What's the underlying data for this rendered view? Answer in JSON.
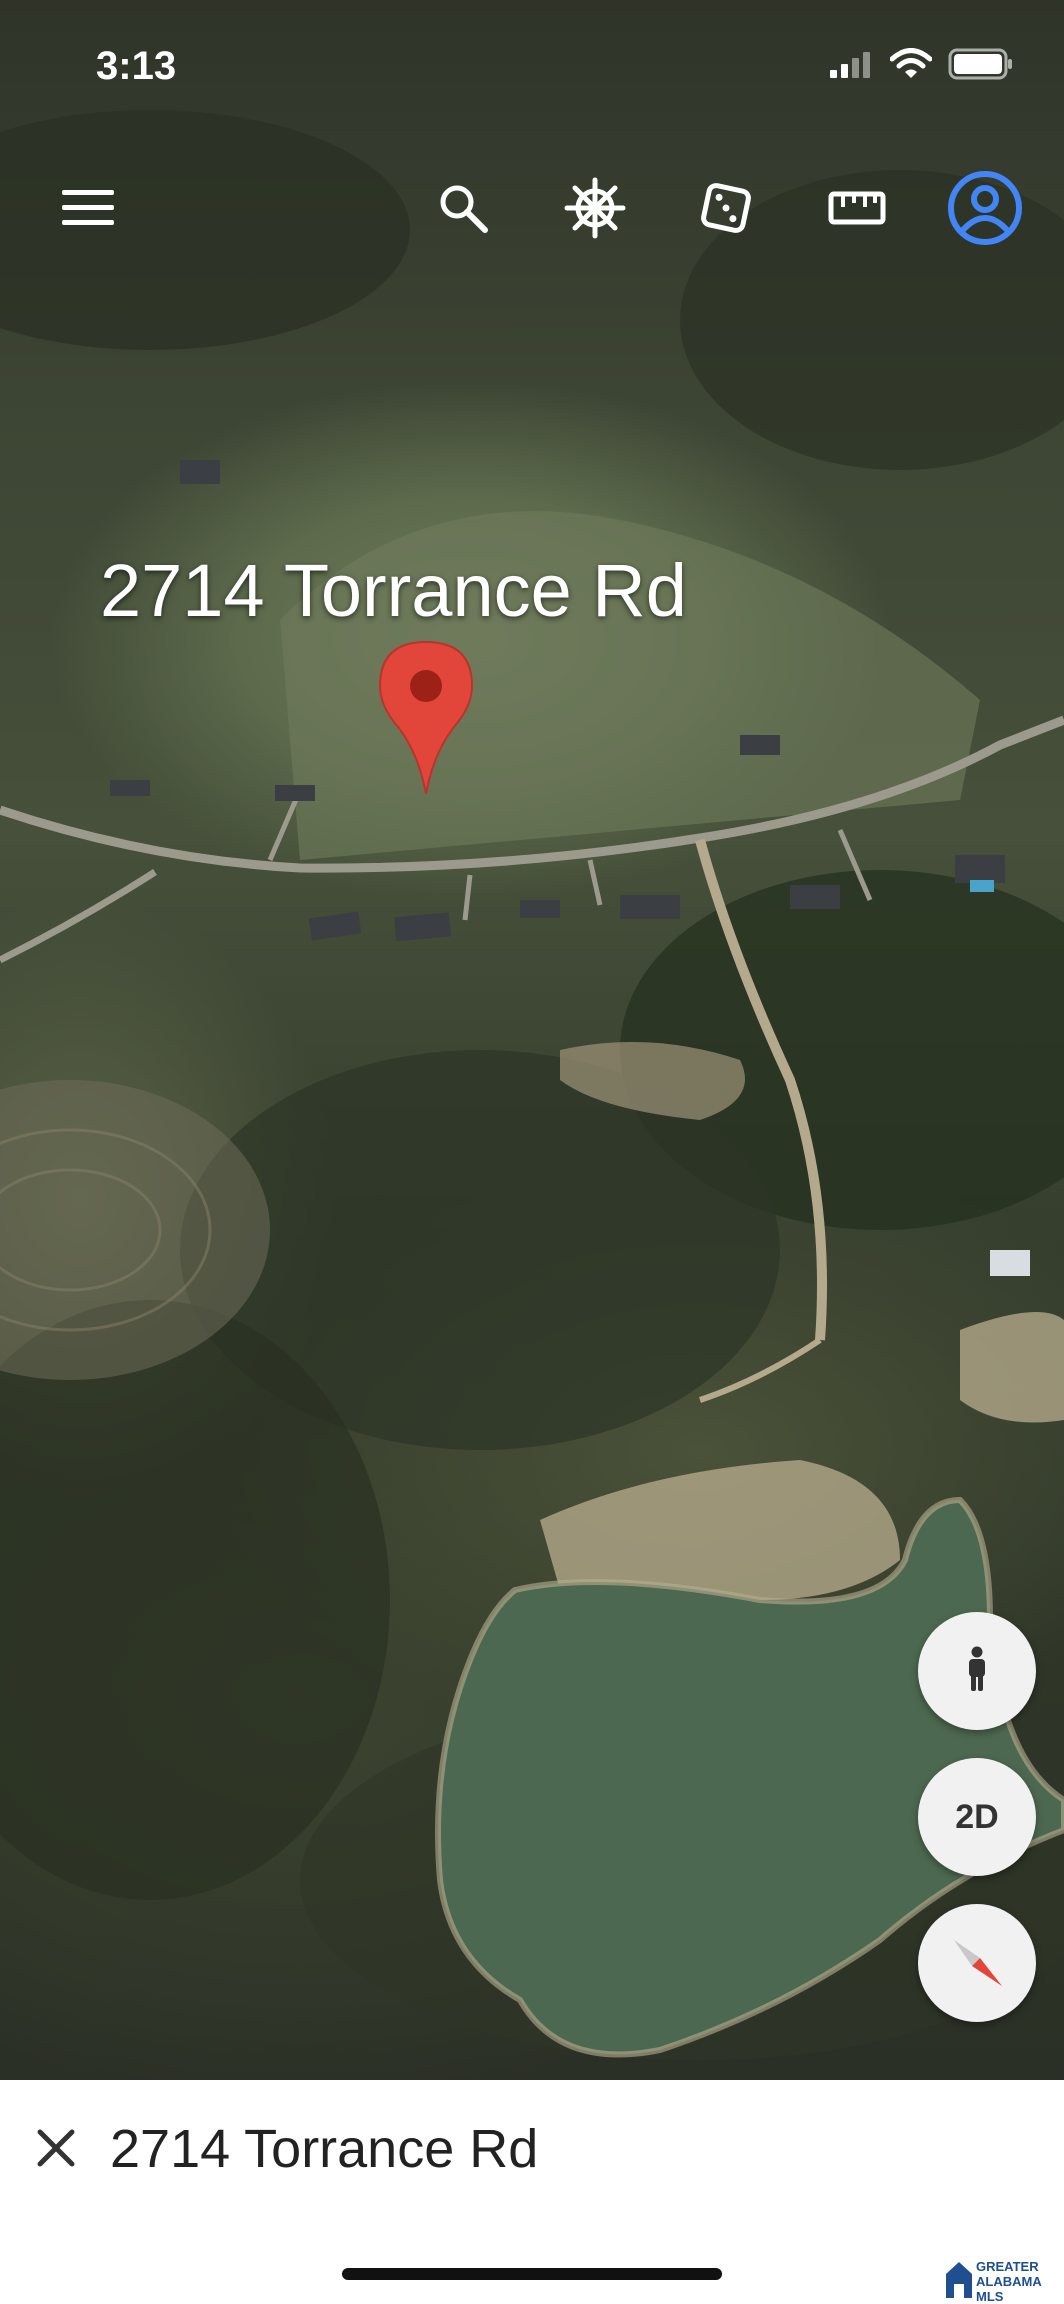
{
  "status_bar": {
    "time": "3:13",
    "icons": [
      "signal-icon",
      "wifi-icon",
      "battery-icon"
    ]
  },
  "toolbar": {
    "icons": [
      "menu-icon",
      "search-icon",
      "voyager-icon",
      "feeling-lucky-icon",
      "measure-icon",
      "account-icon"
    ],
    "account_color": "#4285f4"
  },
  "map": {
    "place_label": "2714 Torrance Rd",
    "pin_color": "#e2463a"
  },
  "controls": {
    "street_view_icon": "pegman-icon",
    "view_mode": "2D",
    "compass_icon": "compass-icon"
  },
  "bottom_sheet": {
    "title": "2714 Torrance Rd",
    "close_icon": "close-icon"
  },
  "watermark": {
    "logo_text": "GREATER ALABAMA MLS"
  }
}
